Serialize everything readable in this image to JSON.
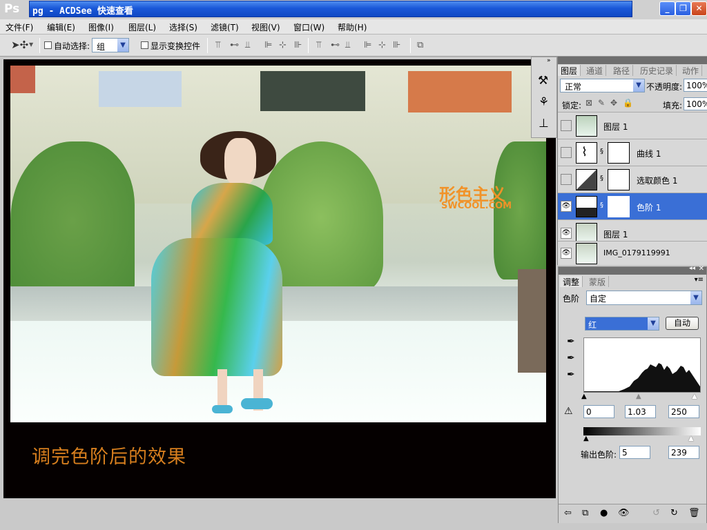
{
  "window": {
    "ps_logo": "Ps",
    "title": "pg - ACDSee 快速查看",
    "btn_minimize": "_",
    "btn_restore": "❐",
    "btn_close": "✕"
  },
  "menu": [
    "文件(F)",
    "编辑(E)",
    "图像(I)",
    "图层(L)",
    "选择(S)",
    "滤镜(T)",
    "视图(V)",
    "窗口(W)",
    "帮助(H)"
  ],
  "options": {
    "auto_select_label": "自动选择:",
    "auto_select_value": "组",
    "show_transform_label": "显示变换控件"
  },
  "document": {
    "caption": "调完色阶后的效果",
    "watermark_cn": "形色主义",
    "watermark_en": "SWCOOL.COM"
  },
  "layers_panel": {
    "tabs": [
      "图层",
      "通道",
      "路径",
      "历史记录",
      "动作"
    ],
    "blend_mode": "正常",
    "opacity_label": "不透明度:",
    "opacity_value": "100%",
    "lock_label": "锁定:",
    "fill_label": "填充:",
    "fill_value": "100%",
    "layers": [
      {
        "name": "图层 1",
        "visible": false,
        "active": false,
        "has_mask": false
      },
      {
        "name": "曲线 1",
        "visible": false,
        "active": false,
        "has_mask": true
      },
      {
        "name": "选取颜色 1",
        "visible": false,
        "active": false,
        "has_mask": true
      },
      {
        "name": "色阶 1",
        "visible": true,
        "active": true,
        "has_mask": true
      },
      {
        "name": "图层 1",
        "visible": true,
        "active": false,
        "has_mask": false
      },
      {
        "name": "IMG_0179119991",
        "visible": true,
        "active": false,
        "has_mask": false
      }
    ]
  },
  "adjustments": {
    "tabs": [
      "调整",
      "蒙版"
    ],
    "preset_label": "色阶",
    "preset_value": "自定",
    "channel_value": "红",
    "auto_button": "自动",
    "input_black": "0",
    "input_gamma": "1.03",
    "input_white": "250",
    "output_label": "输出色阶:",
    "output_black": "5",
    "output_white": "239"
  },
  "colors": {
    "title_bar": "#1a58d8",
    "active_layer": "#3a6fd6",
    "caption": "#d67e1e",
    "watermark": "#f19228"
  }
}
